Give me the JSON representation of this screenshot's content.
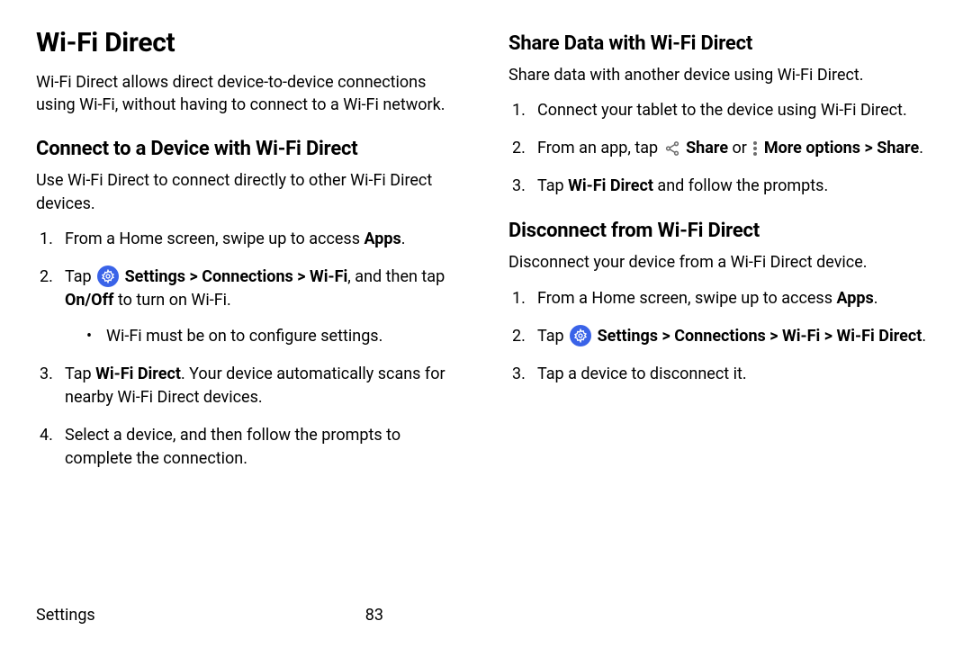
{
  "left": {
    "h1": "Wi-Fi Direct",
    "intro": "Wi-Fi Direct allows direct device-to-device connections using Wi-Fi, without having to connect to a Wi-Fi network.",
    "h2_connect": "Connect to a Device with Wi-Fi Direct",
    "connect_intro": "Use Wi-Fi Direct to connect directly to other Wi-Fi Direct devices.",
    "step1_a": "From a Home screen, swipe up to access ",
    "step1_b": "Apps",
    "step1_c": ".",
    "step2_a": "Tap ",
    "step2_b": " Settings",
    "step2_c": " > ",
    "step2_d": "Connections",
    "step2_e": " > ",
    "step2_f": "Wi-Fi",
    "step2_g": ", and then tap ",
    "step2_h": "On/Off",
    "step2_i": " to turn on Wi-Fi.",
    "bullet1": "Wi-Fi must be on to configure settings.",
    "step3_a": "Tap ",
    "step3_b": "Wi-Fi Direct",
    "step3_c": ". Your device automatically scans for nearby Wi-Fi Direct devices.",
    "step4": "Select a device, and then follow the prompts to complete the connection."
  },
  "right": {
    "h2_share": "Share Data with Wi-Fi Direct",
    "share_intro": "Share data with another device using Wi-Fi Direct.",
    "s_step1": "Connect your tablet to the device using Wi-Fi Direct.",
    "s_step2_a": "From an app, tap ",
    "s_step2_b": " Share",
    "s_step2_c": " or ",
    "s_step2_d": " More options",
    "s_step2_e": " > ",
    "s_step2_f": "Share",
    "s_step2_g": ".",
    "s_step3_a": "Tap ",
    "s_step3_b": "Wi-Fi Direct",
    "s_step3_c": " and follow the prompts.",
    "h2_disconnect": "Disconnect from Wi-Fi Direct",
    "disc_intro": "Disconnect your device from a Wi-Fi Direct device.",
    "d_step1_a": "From a Home screen, swipe up to access ",
    "d_step1_b": "Apps",
    "d_step1_c": ".",
    "d_step2_a": "Tap ",
    "d_step2_b": " Settings",
    "d_step2_c": " > ",
    "d_step2_d": "Connections",
    "d_step2_e": " > ",
    "d_step2_f": "Wi-Fi",
    "d_step2_g": " > ",
    "d_step2_h": "Wi-Fi Direct",
    "d_step2_i": ".",
    "d_step3": "Tap a device to disconnect it."
  },
  "footer": {
    "left": "Settings",
    "page": "83"
  }
}
